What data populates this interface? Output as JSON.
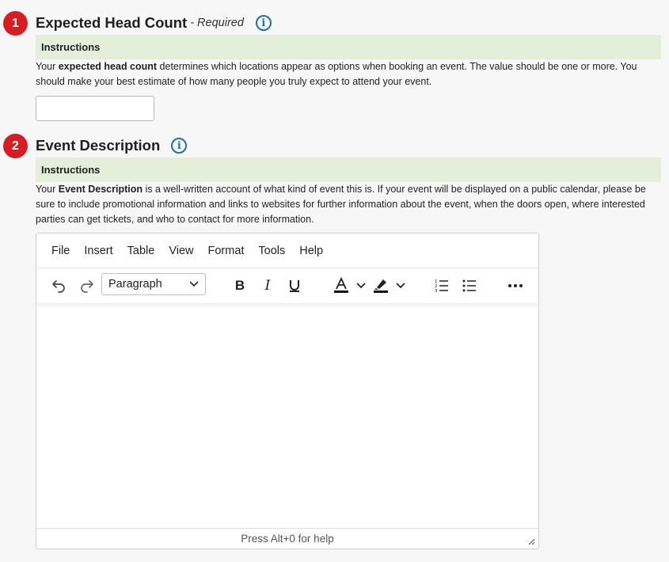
{
  "section1": {
    "step": "1",
    "title": "Expected Head Count",
    "required": "- Required",
    "instructions_label": "Instructions",
    "instr_pre": "Your ",
    "instr_bold": "expected head count",
    "instr_post": " determines which locations appear as options when booking an event.  The value should be one or more.  You should make your best estimate of how many people you truly expect to attend your event.",
    "input_value": ""
  },
  "section2": {
    "step": "2",
    "title": "Event Description",
    "instructions_label": "Instructions",
    "instr_pre": "Your ",
    "instr_bold": "Event Description",
    "instr_post": " is a well-written account of what kind of event this is.  If your event will be displayed on a public calendar, please be sure to include promotional information and links to websites for further information about the event, when the doors open, where interested parties can get tickets, and who to contact for more information."
  },
  "editor": {
    "menu": [
      "File",
      "Insert",
      "Table",
      "View",
      "Format",
      "Tools",
      "Help"
    ],
    "block_format": "Paragraph",
    "status": "Press Alt+0 for help"
  },
  "colors": {
    "badge": "#d71c24",
    "info": "#1b6fb5",
    "instructions_bg": "#e3efd9"
  }
}
